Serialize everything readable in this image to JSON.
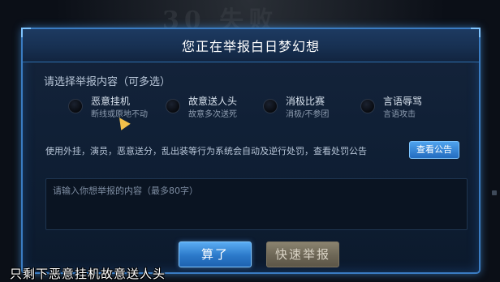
{
  "background": {
    "banner_text": "30 失败"
  },
  "dialog": {
    "title": "您正在举报白日梦幻想",
    "prompt": "请选择举报内容（可多选）",
    "options": [
      {
        "label": "恶意挂机",
        "sublabel": "断线或原地不动",
        "selected": false
      },
      {
        "label": "故意送人头",
        "sublabel": "故意多次送死",
        "selected": false
      },
      {
        "label": "消极比赛",
        "sublabel": "消极/不参团",
        "selected": false
      },
      {
        "label": "言语辱骂",
        "sublabel": "言语攻击",
        "selected": false
      }
    ],
    "notice": "使用外挂，演员，恶意送分，乱出装等行为系统会自动及逆行处罚，查看处罚公告",
    "notice_button": "查看公告",
    "input_placeholder": "请输入你想举报的内容（最多80字）",
    "cancel_button": "算了",
    "report_button": "快速举报"
  },
  "subtitle": "只剩下恶意挂机故意送人头",
  "colors": {
    "accent_blue": "#3a7cc2",
    "button_blue": "#2b79c9",
    "button_disabled": "#6d6656"
  }
}
